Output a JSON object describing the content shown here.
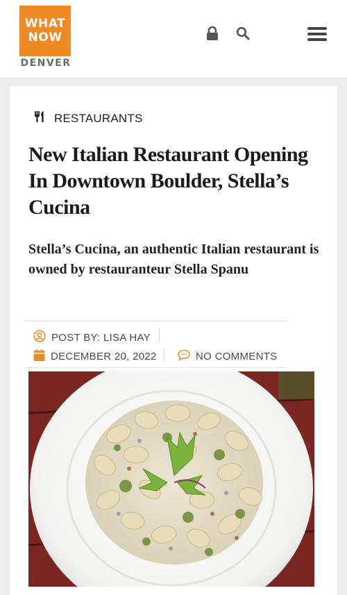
{
  "header": {
    "logo": {
      "line1": "WHAT",
      "line2": "NOW",
      "city": "DENVER"
    },
    "icons": {
      "lock": "lock-icon",
      "search": "search-icon",
      "menu": "hamburger-menu-icon"
    },
    "accent": "#f08a24"
  },
  "article": {
    "category": "RESTAURANTS",
    "category_icon": "utensils-icon",
    "title": "New Italian Restaurant Opening In Downtown Boulder, Stella’s Cucina",
    "excerpt": "Stella’s Cucina, an authentic Italian restaurant is owned by restauranteur Stella Spanu",
    "meta": {
      "author": "POST BY: LISA HAY",
      "date": "DECEMBER 20, 2022",
      "comments": "NO COMMENTS",
      "icon_color": "#f08a24"
    },
    "image_alt": "plate of gnocchi in cream sauce with pesto and herbs"
  }
}
